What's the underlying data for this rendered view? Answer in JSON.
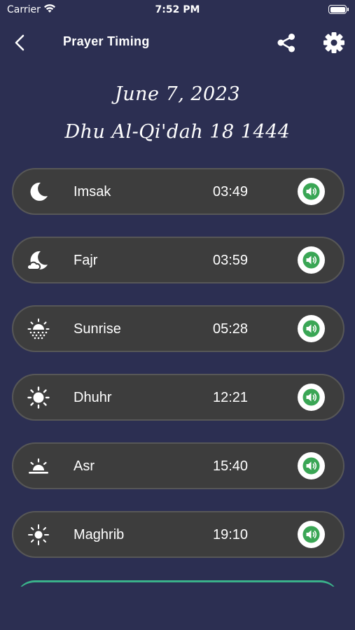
{
  "status_bar": {
    "carrier": "Carrier",
    "time": "7:52 PM"
  },
  "header": {
    "title": "Prayer Timing",
    "icons": {
      "back": "chevron-left-icon",
      "share": "share-icon",
      "settings": "gear-icon"
    }
  },
  "dates": {
    "gregorian": "June 7, 2023",
    "hijri": "Dhu Al-Qi'dah 18 1444"
  },
  "prayers": [
    {
      "name": "Imsak",
      "time": "03:49",
      "icon": "crescent-moon-icon"
    },
    {
      "name": "Fajr",
      "time": "03:59",
      "icon": "moon-cloud-icon"
    },
    {
      "name": "Sunrise",
      "time": "05:28",
      "icon": "sunrise-icon"
    },
    {
      "name": "Dhuhr",
      "time": "12:21",
      "icon": "sun-icon"
    },
    {
      "name": "Asr",
      "time": "15:40",
      "icon": "sun-horizon-icon"
    },
    {
      "name": "Maghrib",
      "time": "19:10",
      "icon": "sunset-icon"
    }
  ],
  "colors": {
    "background": "#2c2f52",
    "row_background": "#3d3d3d",
    "row_border": "#575757",
    "sound_accent": "#3aa655",
    "card_accent": "#3ab28a"
  }
}
